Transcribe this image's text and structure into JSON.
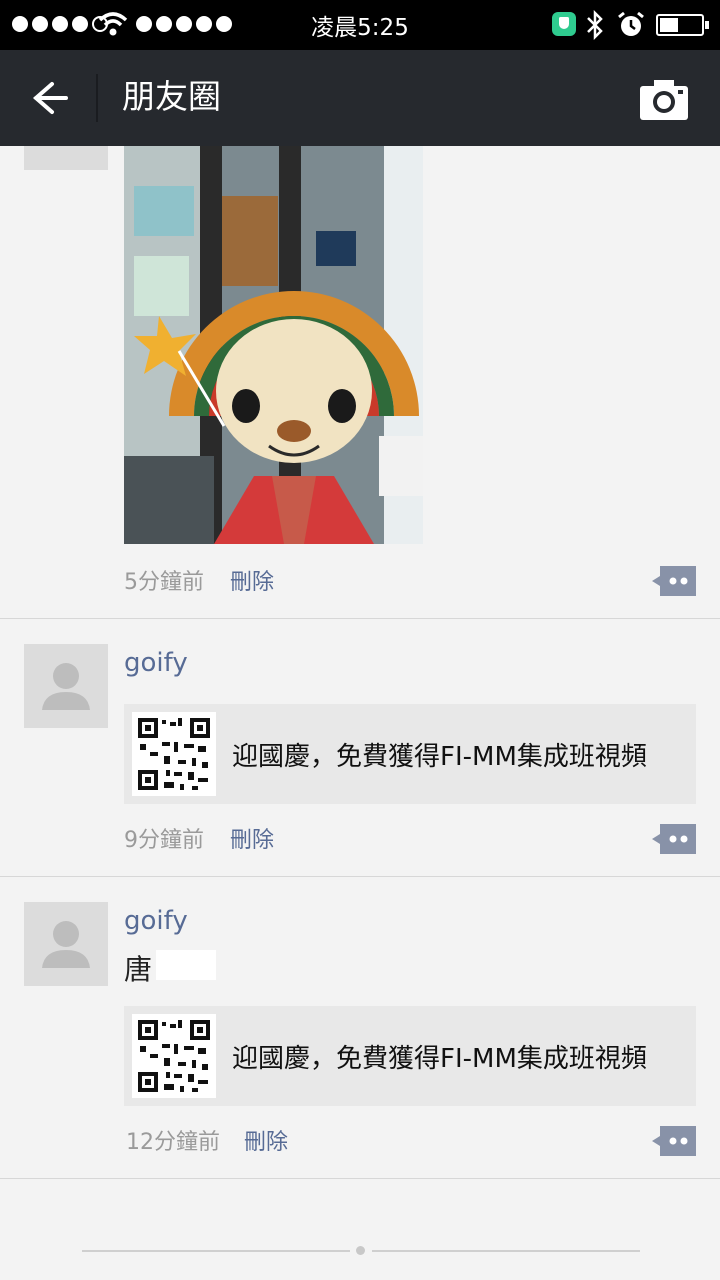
{
  "status_bar": {
    "time": "凌晨5:25",
    "signal_icon": "signal-dots-icon",
    "wifi_icon": "wifi-icon",
    "carrier_icon": "carrier-dots-icon",
    "shield_icon": "shield-icon",
    "bluetooth_icon": "bluetooth-icon",
    "alarm_icon": "alarm-icon",
    "battery_icon": "battery-icon"
  },
  "nav": {
    "title": "朋友圈",
    "back_icon": "arrow-left-icon",
    "camera_icon": "camera-icon"
  },
  "posts": [
    {
      "time": "5分鐘前",
      "delete_label": "刪除",
      "comment_icon": "comment-icon"
    },
    {
      "username": "goify",
      "link_title": "迎國慶，免費獲得FI-MM集成班視頻",
      "time": "9分鐘前",
      "delete_label": "刪除",
      "comment_icon": "comment-icon"
    },
    {
      "username": "goify",
      "text": "唐",
      "link_title": "迎國慶，免費獲得FI-MM集成班視頻",
      "time": "12分鐘前",
      "delete_label": "刪除",
      "comment_icon": "comment-icon"
    }
  ],
  "colors": {
    "nav_background": "#26292e",
    "link_blue": "#576b95",
    "feed_background": "#f3f3f3"
  }
}
